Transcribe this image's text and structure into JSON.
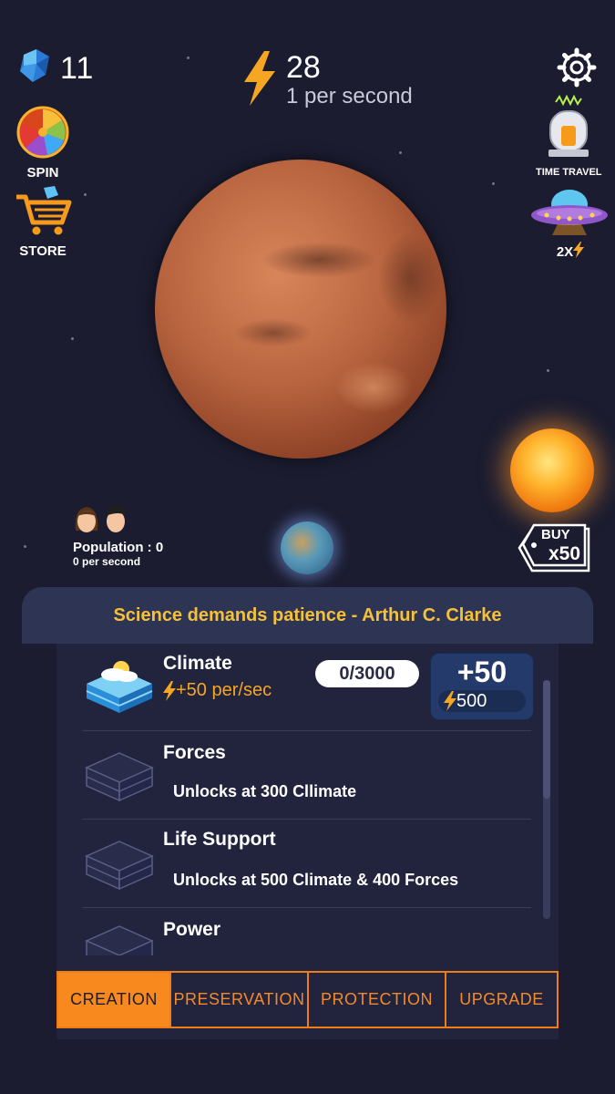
{
  "header": {
    "gems_count": "11",
    "energy_count": "28",
    "energy_rate": "1 per second"
  },
  "side_buttons": {
    "spin_label": "SPIN",
    "store_label": "STORE",
    "time_travel_label": "TIME TRAVEL",
    "boost_label": "2X"
  },
  "population": {
    "label": "Population : 0",
    "rate": "0 per second"
  },
  "buy_tag": {
    "line1": "BUY",
    "line2": "x50"
  },
  "quote": "Science demands patience - Arthur C. Clarke",
  "items": [
    {
      "title": "Climate",
      "rate": "+50 per/sec",
      "progress": "0/3000",
      "buy_amount": "+50",
      "buy_cost": "500"
    },
    {
      "title": "Forces",
      "unlock": "Unlocks at 300 Cllimate"
    },
    {
      "title": "Life Support",
      "unlock": "Unlocks at 500 Climate & 400 Forces"
    },
    {
      "title": "Power"
    }
  ],
  "tabs": [
    "CREATION",
    "PRESERVATION",
    "PROTECTION",
    "UPGRADE"
  ],
  "active_tab": "CREATION",
  "colors": {
    "background": "#1b1c30",
    "accent_orange": "#f7891e",
    "quote_yellow": "#f5c13b",
    "panel": "#22233d"
  }
}
